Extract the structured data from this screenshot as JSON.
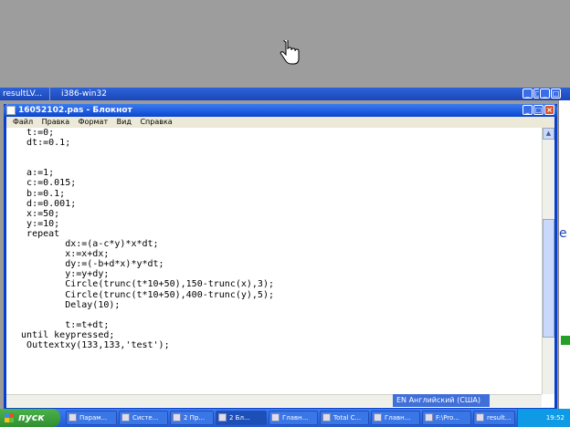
{
  "background_tabs": [
    {
      "label": "resultLV..."
    },
    {
      "label": "i386-win32"
    }
  ],
  "notepad": {
    "title": "16052102.pas - Блокнот",
    "menu": [
      "Файл",
      "Правка",
      "Формат",
      "Вид",
      "Справка"
    ],
    "code": "   t:=0;\n   dt:=0.1;\n\n\n   a:=1;\n   c:=0.015;\n   b:=0.1;\n   d:=0.001;\n   x:=50;\n   y:=10;\n   repeat\n          dx:=(a-c*y)*x*dt;\n          x:=x+dx;\n          dy:=(-b+d*x)*y*dt;\n          y:=y+dy;\n          Circle(trunc(t*10+50),150-trunc(x),3);\n          Circle(trunc(t*10+50),400-trunc(y),5);\n          Delay(10);\n\n          t:=t+dt;\n  until keypressed;\n   Outtextxy(133,133,'test');"
  },
  "side_window": {
    "letter": "e"
  },
  "language_bar": {
    "text": "EN Английский (США)"
  },
  "taskbar": {
    "start_label": "пуск",
    "items": [
      {
        "label": "Парам..."
      },
      {
        "label": "Систе..."
      },
      {
        "label": "2 Пр..."
      },
      {
        "label": "2 Бл..."
      },
      {
        "label": "Главн..."
      },
      {
        "label": "Total C..."
      },
      {
        "label": "Главн..."
      },
      {
        "label": "F:\\Pro..."
      },
      {
        "label": "result..."
      }
    ],
    "clock": "19:52"
  }
}
